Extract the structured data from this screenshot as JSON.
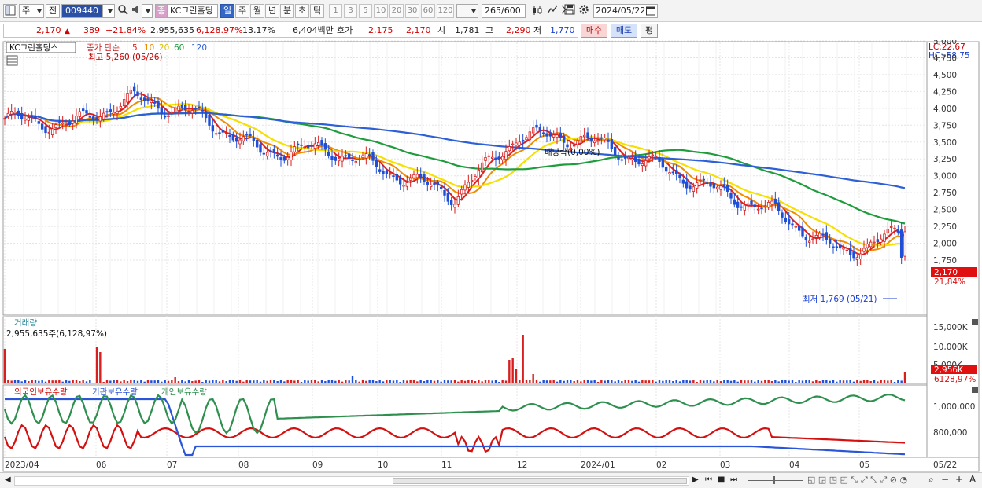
{
  "toolbar": {
    "market_label": "주",
    "prev_label": "전",
    "code": "009440",
    "code_badge": "종",
    "stock_name": "KC그린홀딩",
    "periods": [
      "일",
      "주",
      "월",
      "년",
      "분",
      "초",
      "틱"
    ],
    "active_period": "일",
    "intervals": [
      "1",
      "3",
      "5",
      "10",
      "20",
      "30",
      "60",
      "120"
    ],
    "count": "265",
    "count_total": "/600",
    "date": "2024/05/22"
  },
  "quote": {
    "price": "2,170",
    "change": "389",
    "change_pct": "+21.84%",
    "volume": "2,955,635",
    "volume_ratio": "6,128.97%",
    "turnover": "13.17%",
    "amount": "6,404백만",
    "bid_label": "호가",
    "ask": "2,175",
    "bid": "2,170",
    "open_label": "시",
    "open": "1,781",
    "high_label": "고",
    "high": "2,290",
    "low_label": "저",
    "low": "1,770",
    "buy_label": "매수",
    "sell_label": "매도",
    "eval_label": "평"
  },
  "price_pane": {
    "title": "KC그린홀딩스",
    "ma_prefix": "종가 단순",
    "ma_labels": [
      "5",
      "10",
      "20",
      "60",
      "120"
    ],
    "ma_colors": [
      "#e02020",
      "#f08c00",
      "#f5e000",
      "#1f9c3c",
      "#2d5fd6"
    ],
    "high_note": "최고 5,260 (05/26)",
    "low_note": "최저 1,769 (05/21)",
    "dividend_note": "배당락(0,00%)",
    "lc": "LC:22,67",
    "hc": "HC:-58,75",
    "price_ticks": [
      "5,000",
      "4,750",
      "4,500",
      "4,250",
      "4,000",
      "3,750",
      "3,500",
      "3,250",
      "3,000",
      "2,750",
      "2,500",
      "2,250",
      "2,000",
      "1,750"
    ],
    "current_price_tag": "2,170",
    "current_pct_tag": "21,84%"
  },
  "volume_pane": {
    "title": "거래량",
    "subtitle": "2,955,635주(6,128,97%)",
    "ticks": [
      "15,000K",
      "10,000K",
      "5,000K"
    ],
    "current_tag": "2,956K",
    "pct_tag": "6128,97%"
  },
  "holder_pane": {
    "legend": [
      "외국인보유수량",
      "기관보유수량",
      "개인보유수량"
    ],
    "colors": [
      "#d41010",
      "#2b55d8",
      "#2f8f4e"
    ],
    "ticks": [
      "1,000,000",
      "800,000"
    ]
  },
  "x_axis": {
    "labels": [
      "2023/04",
      "06",
      "07",
      "08",
      "09",
      "10",
      "11",
      "12",
      "2024/01",
      "02",
      "03",
      "04",
      "05"
    ],
    "right_label": "05/22"
  },
  "chart_data": {
    "type": "candlestick",
    "price_close_series": {
      "x": [
        "2023/04",
        "05",
        "06",
        "07",
        "08",
        "09",
        "10",
        "11",
        "12",
        "2024/01",
        "02",
        "03",
        "04",
        "05",
        "05/22"
      ],
      "values": [
        3850,
        3750,
        4150,
        3900,
        3350,
        3400,
        3050,
        2700,
        3600,
        3550,
        3200,
        2800,
        2450,
        1850,
        2170
      ]
    },
    "high": 5260,
    "low": 1769
  }
}
